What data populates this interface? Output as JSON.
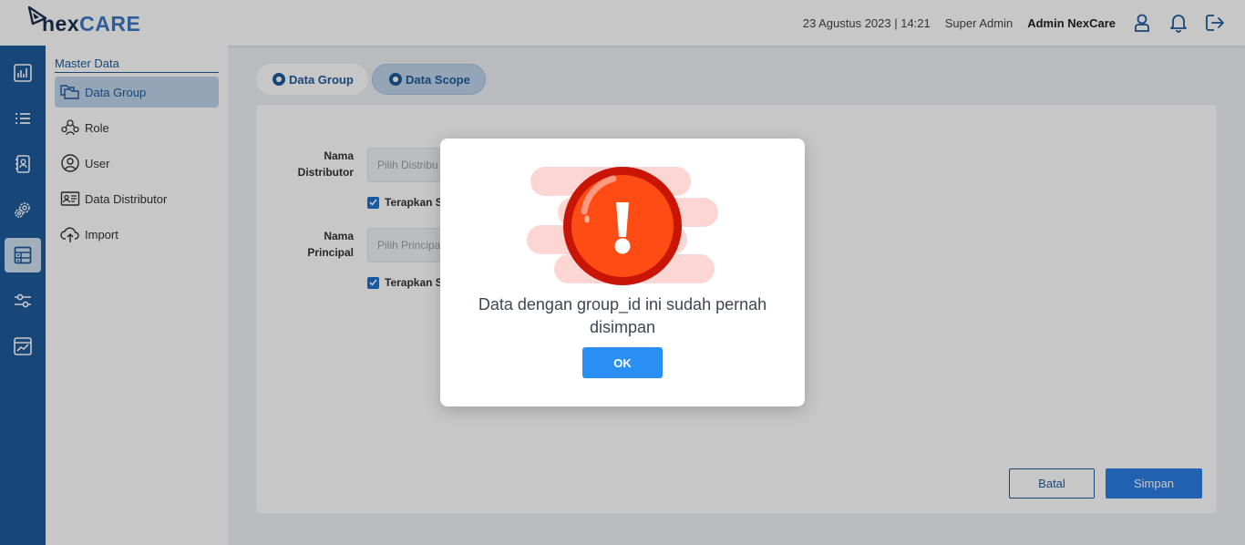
{
  "header": {
    "logo_nex": "nex",
    "logo_care": "CARE",
    "datetime": "23 Agustus 2023 | 14:21",
    "role": "Super Admin",
    "user": "Admin NexCare",
    "icons": [
      "user-icon",
      "bell-icon",
      "logout-icon"
    ]
  },
  "rail": {
    "items": [
      "dashboard-icon",
      "list-icon",
      "contacts-icon",
      "settings-icon",
      "master-data-icon",
      "sliders-icon",
      "chart-icon"
    ],
    "active_index": 4
  },
  "submenu": {
    "title": "Master Data",
    "items": [
      {
        "label": "Data Group",
        "icon": "folders-icon",
        "active": true
      },
      {
        "label": "Role",
        "icon": "role-icon",
        "active": false
      },
      {
        "label": "User",
        "icon": "user-circle-icon",
        "active": false
      },
      {
        "label": "Data Distributor",
        "icon": "id-card-icon",
        "active": false
      },
      {
        "label": "Import",
        "icon": "cloud-upload-icon",
        "active": false
      }
    ]
  },
  "tabs": [
    {
      "label": "Data Group",
      "active": false
    },
    {
      "label": "Data Scope",
      "active": true
    }
  ],
  "form": {
    "distributor_label_1": "Nama",
    "distributor_label_2": "Distributor",
    "distributor_placeholder": "Pilih Distribu",
    "distributor_checkbox": "Terapkan S",
    "principal_label_1": "Nama",
    "principal_label_2": "Principal",
    "principal_placeholder": "Pilih Principa",
    "principal_checkbox": "Terapkan S",
    "cancel_label": "Batal",
    "save_label": "Simpan"
  },
  "modal": {
    "icon": "error-exclamation-icon",
    "message": "Data dengan group_id ini sudah pernah disimpan",
    "ok_label": "OK"
  },
  "colors": {
    "brand_blue": "#1e5a9b",
    "accent_blue": "#2a8ff5",
    "error_red": "#d01a08",
    "error_orange": "#ff4d14"
  }
}
